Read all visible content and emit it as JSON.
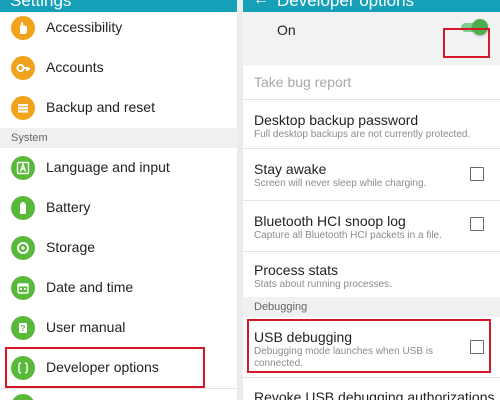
{
  "left": {
    "title": "Settings",
    "items": [
      {
        "label": "Accessibility",
        "icon": "hand-icon",
        "color": "#f2a31c"
      },
      {
        "label": "Accounts",
        "icon": "key-icon",
        "color": "#f2a31c"
      },
      {
        "label": "Backup and reset",
        "icon": "backup-icon",
        "color": "#f2a31c"
      },
      {
        "label": "Language and input",
        "icon": "language-icon",
        "color": "#59b93a"
      },
      {
        "label": "Battery",
        "icon": "battery-icon",
        "color": "#59b93a"
      },
      {
        "label": "Storage",
        "icon": "storage-icon",
        "color": "#59b93a"
      },
      {
        "label": "Date and time",
        "icon": "calendar-icon",
        "color": "#59b93a"
      },
      {
        "label": "User manual",
        "icon": "manual-icon",
        "color": "#59b93a"
      },
      {
        "label": "Developer options",
        "icon": "developer-braces-icon",
        "color": "#59b93a"
      }
    ],
    "section_system": "System"
  },
  "right": {
    "title": "Developer options",
    "on_label": "On",
    "toggle_on": true,
    "items": [
      {
        "title": "Take bug report",
        "subtitle": "",
        "checkbox": false,
        "disabled": true
      },
      {
        "title": "Desktop backup password",
        "subtitle": "Full desktop backups are not currently protected.",
        "checkbox": false,
        "disabled": false
      },
      {
        "title": "Stay awake",
        "subtitle": "Screen will never sleep while charging.",
        "checkbox": true,
        "checked": false,
        "disabled": false
      },
      {
        "title": "Bluetooth HCI snoop log",
        "subtitle": "Capture all Bluetooth HCI packets in a file.",
        "checkbox": true,
        "checked": false,
        "disabled": false
      },
      {
        "title": "Process stats",
        "subtitle": "Stats about running processes.",
        "checkbox": false,
        "disabled": false
      }
    ],
    "section_debugging": "Debugging",
    "usb_debugging": {
      "title": "USB debugging",
      "subtitle": "Debugging mode launches when USB is connected.",
      "checked": false
    },
    "revoke": {
      "title": "Revoke USB debugging authorizations"
    }
  },
  "colors": {
    "app_bar": "#16a0b8",
    "highlight": "#d5172a",
    "toggle_on": "#4cae4f",
    "icon_orange": "#f2a31c",
    "icon_green": "#59b93a"
  }
}
